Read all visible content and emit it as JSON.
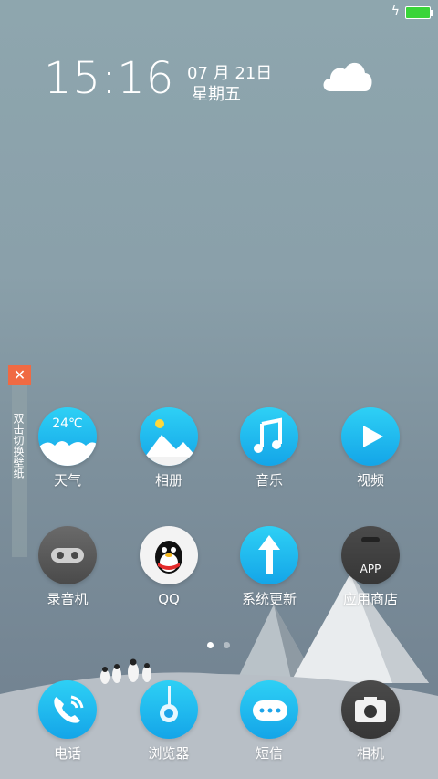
{
  "status": {
    "battery_color": "#39d539",
    "charging_icon": "lightning-icon"
  },
  "clock": {
    "time": "15:16",
    "date": "07 月 21日",
    "weekday": "星期五",
    "weather_icon": "cloud-icon"
  },
  "wallpaper_tab": {
    "close_glyph": "✕",
    "label": "双击切换壁纸"
  },
  "apps": [
    {
      "label": "天气",
      "icon": "weather-icon",
      "temp": "24℃"
    },
    {
      "label": "相册",
      "icon": "gallery-icon"
    },
    {
      "label": "音乐",
      "icon": "music-icon"
    },
    {
      "label": "视频",
      "icon": "video-icon"
    },
    {
      "label": "录音机",
      "icon": "recorder-icon"
    },
    {
      "label": "QQ",
      "icon": "qq-icon"
    },
    {
      "label": "系统更新",
      "icon": "system-update-icon"
    },
    {
      "label": "应用商店",
      "icon": "app-store-icon",
      "badge_text": "APP"
    }
  ],
  "dock": [
    {
      "label": "电话",
      "icon": "phone-icon"
    },
    {
      "label": "浏览器",
      "icon": "browser-icon"
    },
    {
      "label": "短信",
      "icon": "messages-icon"
    },
    {
      "label": "相机",
      "icon": "camera-icon"
    }
  ],
  "page_indicator": {
    "pages": 2,
    "current": 1
  },
  "colors": {
    "accent_blue": "#14a5e8",
    "close_orange": "#f06a43"
  }
}
